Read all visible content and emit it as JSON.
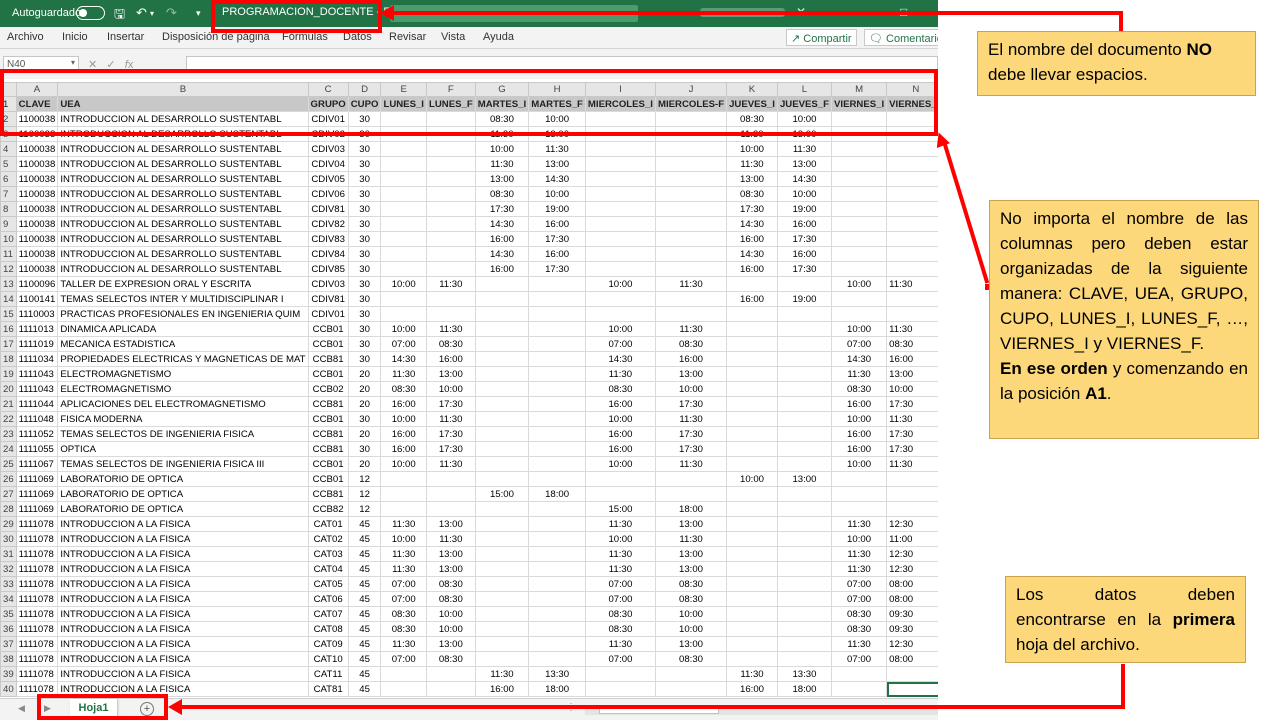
{
  "titlebar": {
    "autosave_label": "Autoguardado",
    "doc_title": "PROGRAMACION_DOCENTE  -  Excel"
  },
  "ribbon": {
    "tabs": [
      "Archivo",
      "Inicio",
      "Insertar",
      "Disposición de página",
      "Fórmulas",
      "Datos",
      "Revisar",
      "Vista",
      "Ayuda"
    ],
    "share_label": "Compartir",
    "comments_label": "Comentarios"
  },
  "formula_bar": {
    "name_box": "N40"
  },
  "sheet": {
    "columns": [
      "A",
      "B",
      "C",
      "D",
      "E",
      "F",
      "G",
      "H",
      "I",
      "J",
      "K",
      "L",
      "M",
      "N"
    ],
    "header_row": [
      "CLAVE",
      "UEA",
      "GRUPO",
      "CUPO",
      "LUNES_I",
      "LUNES_F",
      "MARTES_I",
      "MARTES_F",
      "MIERCOLES_I",
      "MIERCOLES-F",
      "JUEVES_I",
      "JUEVES_F",
      "VIERNES_I",
      "VIERNES_F"
    ],
    "rows": [
      [
        "2",
        "1100038",
        "INTRODUCCION AL DESARROLLO SUSTENTABL",
        "CDIV01",
        "30",
        "",
        "",
        "08:30",
        "10:00",
        "",
        "",
        "08:30",
        "10:00",
        "",
        ""
      ],
      [
        "3",
        "1100038",
        "INTRODUCCION AL DESARROLLO SUSTENTABL",
        "CDIV02",
        "30",
        "",
        "",
        "11:30",
        "13:00",
        "",
        "",
        "11:30",
        "13:00",
        "",
        ""
      ],
      [
        "4",
        "1100038",
        "INTRODUCCION AL DESARROLLO SUSTENTABL",
        "CDIV03",
        "30",
        "",
        "",
        "10:00",
        "11:30",
        "",
        "",
        "10:00",
        "11:30",
        "",
        ""
      ],
      [
        "5",
        "1100038",
        "INTRODUCCION AL DESARROLLO SUSTENTABL",
        "CDIV04",
        "30",
        "",
        "",
        "11:30",
        "13:00",
        "",
        "",
        "11:30",
        "13:00",
        "",
        ""
      ],
      [
        "6",
        "1100038",
        "INTRODUCCION AL DESARROLLO SUSTENTABL",
        "CDIV05",
        "30",
        "",
        "",
        "13:00",
        "14:30",
        "",
        "",
        "13:00",
        "14:30",
        "",
        ""
      ],
      [
        "7",
        "1100038",
        "INTRODUCCION AL DESARROLLO SUSTENTABL",
        "CDIV06",
        "30",
        "",
        "",
        "08:30",
        "10:00",
        "",
        "",
        "08:30",
        "10:00",
        "",
        ""
      ],
      [
        "8",
        "1100038",
        "INTRODUCCION AL DESARROLLO SUSTENTABL",
        "CDIV81",
        "30",
        "",
        "",
        "17:30",
        "19:00",
        "",
        "",
        "17:30",
        "19:00",
        "",
        ""
      ],
      [
        "9",
        "1100038",
        "INTRODUCCION AL DESARROLLO SUSTENTABL",
        "CDIV82",
        "30",
        "",
        "",
        "14:30",
        "16:00",
        "",
        "",
        "14:30",
        "16:00",
        "",
        ""
      ],
      [
        "10",
        "1100038",
        "INTRODUCCION AL DESARROLLO SUSTENTABL",
        "CDIV83",
        "30",
        "",
        "",
        "16:00",
        "17:30",
        "",
        "",
        "16:00",
        "17:30",
        "",
        ""
      ],
      [
        "11",
        "1100038",
        "INTRODUCCION AL DESARROLLO SUSTENTABL",
        "CDIV84",
        "30",
        "",
        "",
        "14:30",
        "16:00",
        "",
        "",
        "14:30",
        "16:00",
        "",
        ""
      ],
      [
        "12",
        "1100038",
        "INTRODUCCION AL DESARROLLO SUSTENTABL",
        "CDIV85",
        "30",
        "",
        "",
        "16:00",
        "17:30",
        "",
        "",
        "16:00",
        "17:30",
        "",
        ""
      ],
      [
        "13",
        "1100096",
        "TALLER DE EXPRESION ORAL Y ESCRITA",
        "CDIV03",
        "30",
        "10:00",
        "11:30",
        "",
        "",
        "10:00",
        "11:30",
        "",
        "",
        "10:00",
        "11:30"
      ],
      [
        "14",
        "1100141",
        "TEMAS SELECTOS INTER Y MULTIDISCIPLINAR I",
        "CDIV81",
        "30",
        "",
        "",
        "",
        "",
        "",
        "",
        "16:00",
        "19:00",
        "",
        ""
      ],
      [
        "15",
        "1110003",
        "PRACTICAS PROFESIONALES EN INGENIERIA QUIM",
        "CDIV01",
        "30",
        "",
        "",
        "",
        "",
        "",
        "",
        "",
        "",
        "",
        ""
      ],
      [
        "16",
        "1111013",
        "DINAMICA APLICADA",
        "CCB01",
        "30",
        "10:00",
        "11:30",
        "",
        "",
        "10:00",
        "11:30",
        "",
        "",
        "10:00",
        "11:30"
      ],
      [
        "17",
        "1111019",
        "MECANICA ESTADISTICA",
        "CCB01",
        "30",
        "07:00",
        "08:30",
        "",
        "",
        "07:00",
        "08:30",
        "",
        "",
        "07:00",
        "08:30"
      ],
      [
        "18",
        "1111034",
        " PROPIEDADES ELECTRICAS Y MAGNETICAS DE MAT",
        "CCB81",
        "30",
        "14:30",
        "16:00",
        "",
        "",
        "14:30",
        "16:00",
        "",
        "",
        "14:30",
        "16:00"
      ],
      [
        "19",
        "1111043",
        "ELECTROMAGNETISMO",
        "CCB01",
        "20",
        "11:30",
        "13:00",
        "",
        "",
        "11:30",
        "13:00",
        "",
        "",
        "11:30",
        "13:00"
      ],
      [
        "20",
        "1111043",
        "ELECTROMAGNETISMO",
        "CCB02",
        "20",
        "08:30",
        "10:00",
        "",
        "",
        "08:30",
        "10:00",
        "",
        "",
        "08:30",
        "10:00"
      ],
      [
        "21",
        "1111044",
        "APLICACIONES DEL ELECTROMAGNETISMO",
        "CCB81",
        "20",
        "16:00",
        "17:30",
        "",
        "",
        "16:00",
        "17:30",
        "",
        "",
        "16:00",
        "17:30"
      ],
      [
        "22",
        "1111048",
        "FISICA MODERNA",
        "CCB01",
        "30",
        "10:00",
        "11:30",
        "",
        "",
        "10:00",
        "11:30",
        "",
        "",
        "10:00",
        "11:30"
      ],
      [
        "23",
        "1111052",
        "TEMAS SELECTOS DE INGENIERIA FISICA",
        "CCB81",
        "20",
        "16:00",
        "17:30",
        "",
        "",
        "16:00",
        "17:30",
        "",
        "",
        "16:00",
        "17:30"
      ],
      [
        "24",
        "1111055",
        "OPTICA",
        "CCB81",
        "30",
        "16:00",
        "17:30",
        "",
        "",
        "16:00",
        "17:30",
        "",
        "",
        "16:00",
        "17:30"
      ],
      [
        "25",
        "1111067",
        "TEMAS SELECTOS DE INGENIERIA FISICA III",
        "CCB01",
        "20",
        "10:00",
        "11:30",
        "",
        "",
        "10:00",
        "11:30",
        "",
        "",
        "10:00",
        "11:30"
      ],
      [
        "26",
        "1111069",
        "LABORATORIO DE OPTICA",
        "CCB01",
        "12",
        "",
        "",
        "",
        "",
        "",
        "",
        "10:00",
        "13:00",
        "",
        ""
      ],
      [
        "27",
        "1111069",
        "LABORATORIO DE OPTICA",
        "CCB81",
        "12",
        "",
        "",
        "15:00",
        "18:00",
        "",
        "",
        "",
        "",
        "",
        ""
      ],
      [
        "28",
        "1111069",
        "LABORATORIO DE OPTICA",
        "CCB82",
        "12",
        "",
        "",
        "",
        "",
        "15:00",
        "18:00",
        "",
        "",
        "",
        ""
      ],
      [
        "29",
        "1111078",
        "INTRODUCCION A LA FISICA",
        "CAT01",
        "45",
        "11:30",
        "13:00",
        "",
        "",
        "11:30",
        "13:00",
        "",
        "",
        "11:30",
        "12:30"
      ],
      [
        "30",
        "1111078",
        "INTRODUCCION A LA FISICA",
        "CAT02",
        "45",
        "10:00",
        "11:30",
        "",
        "",
        "10:00",
        "11:30",
        "",
        "",
        "10:00",
        "11:00"
      ],
      [
        "31",
        "1111078",
        "INTRODUCCION A LA FISICA",
        "CAT03",
        "45",
        "11:30",
        "13:00",
        "",
        "",
        "11:30",
        "13:00",
        "",
        "",
        "11:30",
        "12:30"
      ],
      [
        "32",
        "1111078",
        "INTRODUCCION A LA FISICA",
        "CAT04",
        "45",
        "11:30",
        "13:00",
        "",
        "",
        "11:30",
        "13:00",
        "",
        "",
        "11:30",
        "12:30"
      ],
      [
        "33",
        "1111078",
        "INTRODUCCION A LA FISICA",
        "CAT05",
        "45",
        "07:00",
        "08:30",
        "",
        "",
        "07:00",
        "08:30",
        "",
        "",
        "07:00",
        "08:00"
      ],
      [
        "34",
        "1111078",
        "INTRODUCCION A LA FISICA",
        "CAT06",
        "45",
        "07:00",
        "08:30",
        "",
        "",
        "07:00",
        "08:30",
        "",
        "",
        "07:00",
        "08:00"
      ],
      [
        "35",
        "1111078",
        "INTRODUCCION A LA FISICA",
        "CAT07",
        "45",
        "08:30",
        "10:00",
        "",
        "",
        "08:30",
        "10:00",
        "",
        "",
        "08:30",
        "09:30"
      ],
      [
        "36",
        "1111078",
        "INTRODUCCION A LA FISICA",
        "CAT08",
        "45",
        "08:30",
        "10:00",
        "",
        "",
        "08:30",
        "10:00",
        "",
        "",
        "08:30",
        "09:30"
      ],
      [
        "37",
        "1111078",
        "INTRODUCCION A LA FISICA",
        "CAT09",
        "45",
        "11:30",
        "13:00",
        "",
        "",
        "11:30",
        "13:00",
        "",
        "",
        "11:30",
        "12:30"
      ],
      [
        "38",
        "1111078",
        "INTRODUCCION A LA FISICA",
        "CAT10",
        "45",
        "07:00",
        "08:30",
        "",
        "",
        "07:00",
        "08:30",
        "",
        "",
        "07:00",
        "08:00"
      ],
      [
        "39",
        "1111078",
        "INTRODUCCION A LA FISICA",
        "CAT11",
        "45",
        "",
        "",
        "11:30",
        "13:30",
        "",
        "",
        "11:30",
        "13:30",
        "",
        ""
      ],
      [
        "40",
        "1111078",
        "INTRODUCCION A LA FISICA",
        "CAT81",
        "45",
        "",
        "",
        "16:00",
        "18:00",
        "",
        "",
        "16:00",
        "18:00",
        "",
        ""
      ]
    ],
    "header_row_number": "1"
  },
  "statusbar": {
    "sheet_tab": "Hoja1",
    "add_sheet": "+"
  },
  "callouts": {
    "name": [
      "El nombre del documento ",
      "NO",
      " debe llevar espacios."
    ],
    "columns_text": "No importa el nombre de las columnas pero deben estar organizadas de la siguiente manera: CLAVE, UEA, GRUPO, CUPO, LUNES_I, LUNES_F, …, VIERNES_I y VIERNES_F.",
    "order_bold": "En ese orden",
    "order_rest": " y comenzando en la posición ",
    "order_cell": "A1",
    "order_end": ".",
    "sheet_1": "Los datos deben encontrarse en la ",
    "sheet_bold": "primera",
    "sheet_2": " hoja del archivo."
  },
  "colors": {
    "excel_green": "#217346",
    "annotation_red": "#ff0000",
    "callout_fill": "#fdd87a"
  }
}
